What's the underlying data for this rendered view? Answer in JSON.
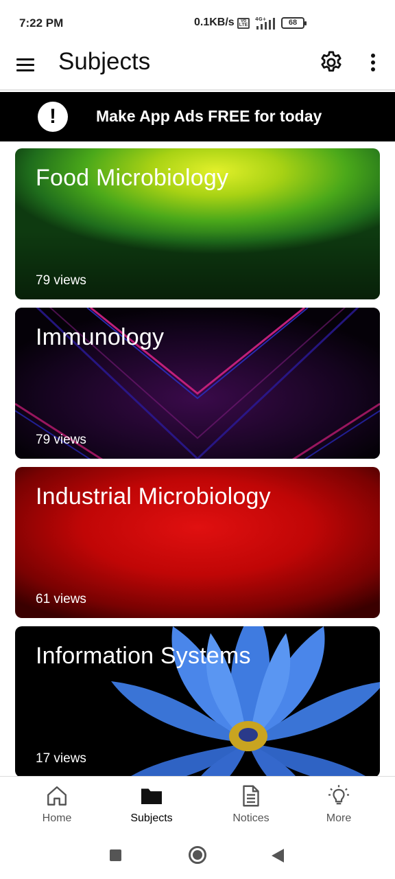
{
  "status_bar": {
    "time": "7:22 PM",
    "network_speed": "0.1KB/s",
    "network_type": "4G+",
    "battery": "68"
  },
  "app_bar": {
    "title": "Subjects",
    "menu_icon": "hamburger-menu-icon",
    "settings_icon": "gear-icon",
    "overflow_icon": "kebab-menu-icon"
  },
  "promo": {
    "icon": "exclamation-icon",
    "text": "Make App Ads FREE for today"
  },
  "subjects": [
    {
      "title": "Food Microbiology",
      "views": "79 views",
      "theme": "green-gradient"
    },
    {
      "title": "Immunology",
      "views": "79 views",
      "theme": "dark-chevron"
    },
    {
      "title": "Industrial Microbiology",
      "views": "61 views",
      "theme": "red-texture"
    },
    {
      "title": "Information Systems",
      "views": "17 views",
      "theme": "blue-lotus"
    }
  ],
  "bottom_nav": {
    "items": [
      {
        "label": "Home",
        "icon": "home-icon",
        "active": false
      },
      {
        "label": "Subjects",
        "icon": "folder-icon",
        "active": true
      },
      {
        "label": "Notices",
        "icon": "document-icon",
        "active": false
      },
      {
        "label": "More",
        "icon": "lightbulb-icon",
        "active": false
      }
    ]
  },
  "colors": {
    "app_bar_bg": "#ffffff",
    "promo_bg": "#000000",
    "text_primary": "#111111"
  }
}
